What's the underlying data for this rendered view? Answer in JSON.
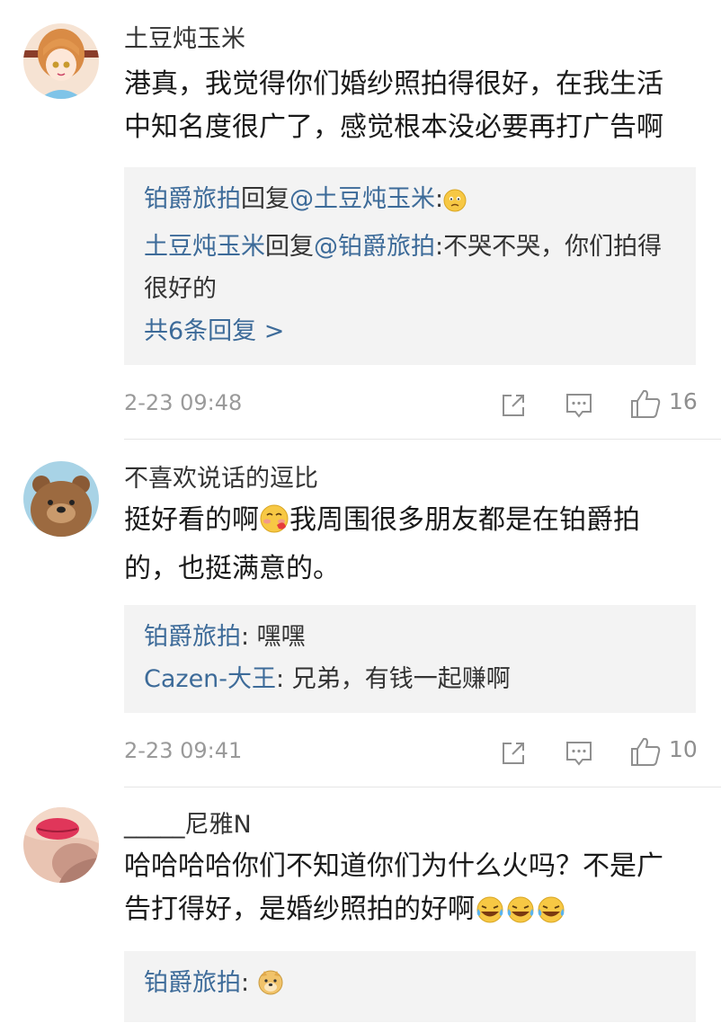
{
  "comments": [
    {
      "username": "土豆炖玉米",
      "text": "港真，我觉得你们婚纱照拍得很好，在我生活中知名度很广了，感觉根本没必要再打广告啊",
      "replies": [
        {
          "name": "铂爵旅拍",
          "mid": "回复",
          "target": "@土豆炖玉米",
          "colon": ":",
          "text": "",
          "emoji": "sad-face-emoji"
        },
        {
          "name": "土豆炖玉米",
          "mid": "回复",
          "target": "@铂爵旅拍",
          "colon": ":",
          "text": "不哭不哭，你们拍得很好的"
        }
      ],
      "more": "共6条回复 >",
      "time": "2-23 09:48",
      "likes": "16"
    },
    {
      "username": "不喜欢说话的逗比",
      "text_a": "挺好看的啊",
      "text_b": "我周围很多朋友都是在铂爵拍的，也挺满意的。",
      "replies": [
        {
          "name": "铂爵旅拍",
          "text": ": 嘿嘿"
        },
        {
          "name": "Cazen-大王",
          "text": ": 兄弟，有钱一起赚啊"
        }
      ],
      "time": "2-23 09:41",
      "likes": "10"
    },
    {
      "username": "_____尼雅N",
      "text": "哈哈哈哈你们不知道你们为什么火吗？不是广告打得好，是婚纱照拍的好啊",
      "replies": [
        {
          "name": "铂爵旅拍",
          "text": ": ",
          "emoji": "doge-emoji"
        }
      ]
    }
  ],
  "colors": {
    "link": "#3d6b99",
    "reply_bg": "#f3f3f3",
    "meta": "#9a9a9a"
  }
}
